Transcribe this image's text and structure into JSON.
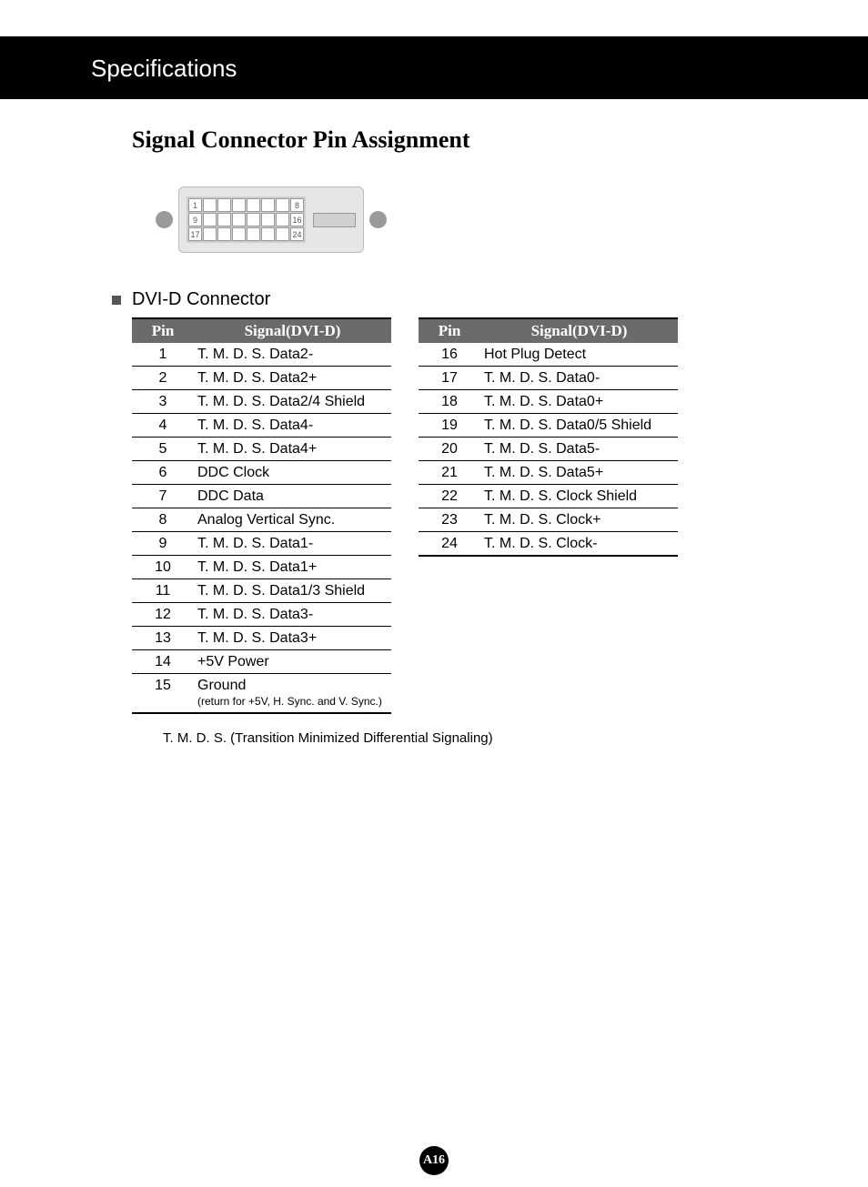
{
  "header": "Specifications",
  "title": "Signal Connector Pin Assignment",
  "diagram": {
    "corner_pins": [
      "1",
      "8",
      "9",
      "16",
      "17",
      "24"
    ]
  },
  "subheading": "DVI-D Connector",
  "table_headers": {
    "pin": "Pin",
    "signal": "Signal(DVI-D)"
  },
  "left_table": [
    {
      "pin": "1",
      "signal": "T. M. D. S. Data2-"
    },
    {
      "pin": "2",
      "signal": "T. M. D. S. Data2+"
    },
    {
      "pin": "3",
      "signal": "T. M. D. S. Data2/4 Shield"
    },
    {
      "pin": "4",
      "signal": "T. M. D. S. Data4-"
    },
    {
      "pin": "5",
      "signal": "T. M. D. S. Data4+"
    },
    {
      "pin": "6",
      "signal": "DDC Clock"
    },
    {
      "pin": "7",
      "signal": "DDC Data"
    },
    {
      "pin": "8",
      "signal": "Analog Vertical Sync."
    },
    {
      "pin": "9",
      "signal": "T. M. D. S. Data1-"
    },
    {
      "pin": "10",
      "signal": "T. M. D. S. Data1+"
    },
    {
      "pin": "11",
      "signal": "T. M. D. S. Data1/3 Shield"
    },
    {
      "pin": "12",
      "signal": "T. M. D. S. Data3-"
    },
    {
      "pin": "13",
      "signal": "T. M. D. S. Data3+"
    },
    {
      "pin": "14",
      "signal": "+5V Power"
    },
    {
      "pin": "15",
      "signal": "Ground",
      "sub": "(return for +5V, H. Sync. and V. Sync.)"
    }
  ],
  "right_table": [
    {
      "pin": "16",
      "signal": "Hot Plug Detect"
    },
    {
      "pin": "17",
      "signal": "T. M. D. S. Data0-"
    },
    {
      "pin": "18",
      "signal": "T. M. D. S. Data0+"
    },
    {
      "pin": "19",
      "signal": "T. M. D. S. Data0/5 Shield"
    },
    {
      "pin": "20",
      "signal": "T. M. D. S. Data5-"
    },
    {
      "pin": "21",
      "signal": "T. M. D. S. Data5+"
    },
    {
      "pin": "22",
      "signal": "T. M. D. S. Clock Shield"
    },
    {
      "pin": "23",
      "signal": "T. M. D. S. Clock+"
    },
    {
      "pin": "24",
      "signal": "T. M. D. S. Clock-"
    }
  ],
  "footnote": "T. M. D. S. (Transition Minimized Differential Signaling)",
  "page_number": "A16"
}
